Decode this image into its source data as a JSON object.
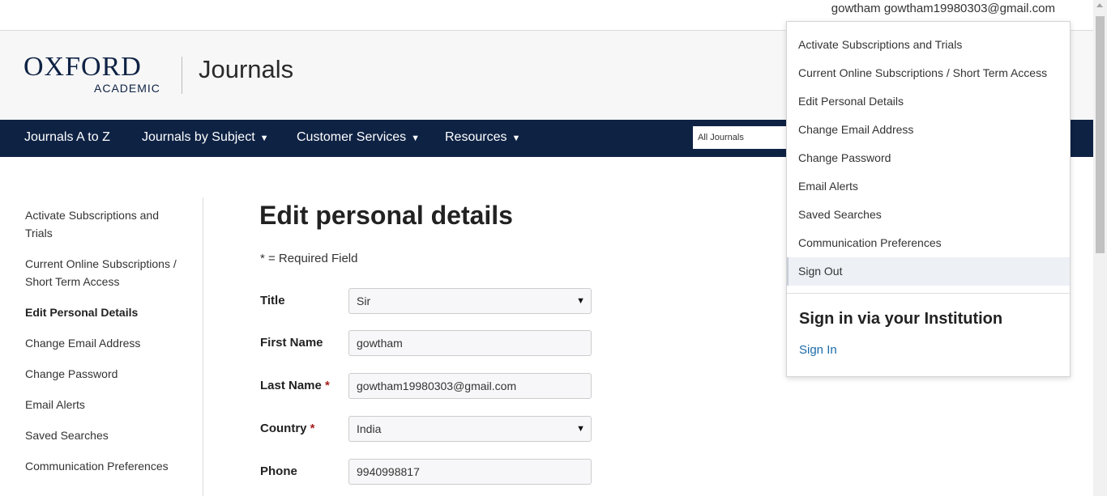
{
  "user": {
    "display": "gowtham gowtham19980303@gmail.com"
  },
  "header": {
    "logo_oxford": "OXFORD",
    "logo_academic": "ACADEMIC",
    "section": "Journals"
  },
  "nav": {
    "items": [
      {
        "label": "Journals A to Z"
      },
      {
        "label": "Journals by Subject"
      },
      {
        "label": "Customer Services"
      },
      {
        "label": "Resources"
      }
    ],
    "search_scope": "All Journals"
  },
  "sidebar": {
    "items": [
      {
        "label": "Activate Subscriptions and Trials"
      },
      {
        "label": "Current Online Subscriptions / Short Term Access"
      },
      {
        "label": "Edit Personal Details"
      },
      {
        "label": "Change Email Address"
      },
      {
        "label": "Change Password"
      },
      {
        "label": "Email Alerts"
      },
      {
        "label": "Saved Searches"
      },
      {
        "label": "Communication Preferences"
      }
    ]
  },
  "main": {
    "title": "Edit personal details",
    "required_note": "* = Required Field",
    "fields": {
      "title": {
        "label": "Title",
        "value": "Sir"
      },
      "first_name": {
        "label": "First Name",
        "value": "gowtham"
      },
      "last_name": {
        "label": "Last Name",
        "required": "*",
        "value": "gowtham19980303@gmail.com"
      },
      "country": {
        "label": "Country",
        "required": "*",
        "value": "India"
      },
      "phone": {
        "label": "Phone",
        "value": "9940998817"
      }
    }
  },
  "dropdown": {
    "items": [
      {
        "label": "Activate Subscriptions and Trials"
      },
      {
        "label": "Current Online Subscriptions / Short Term Access"
      },
      {
        "label": "Edit Personal Details"
      },
      {
        "label": "Change Email Address"
      },
      {
        "label": "Change Password"
      },
      {
        "label": "Email Alerts"
      },
      {
        "label": "Saved Searches"
      },
      {
        "label": "Communication Preferences"
      },
      {
        "label": "Sign Out"
      }
    ],
    "institution_title": "Sign in via your Institution",
    "signin_link": "Sign In"
  },
  "colors": {
    "nav_bg": "#0e2244",
    "required_star": "#a61e1e",
    "link": "#1a6aa8"
  },
  "icons": {
    "dropdown_caret": "caret-down-icon",
    "select_arrow": "select-arrow-icon"
  }
}
